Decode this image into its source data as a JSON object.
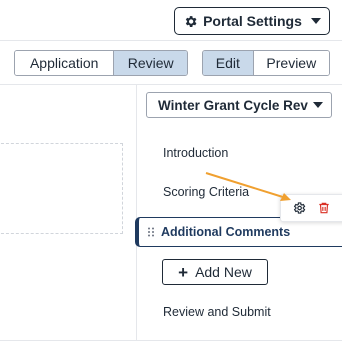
{
  "header": {
    "portal_settings_label": "Portal Settings",
    "portal_settings_icon": "gear-icon",
    "portal_settings_caret": "chevron-down-icon"
  },
  "mode_toggle": {
    "options": [
      {
        "label": "Application",
        "active": false
      },
      {
        "label": "Review",
        "active": true
      }
    ]
  },
  "view_toggle": {
    "options": [
      {
        "label": "Edit",
        "active": true
      },
      {
        "label": "Preview",
        "active": false
      }
    ]
  },
  "cycle_select": {
    "value": "Winter Grant Cycle Rev",
    "caret_icon": "chevron-down-icon"
  },
  "sections": {
    "items": [
      {
        "label": "Introduction"
      },
      {
        "label": "Scoring Criteria"
      },
      {
        "label": "Additional Comments",
        "active": true
      },
      {
        "label": "Review and Submit"
      }
    ],
    "add_new_label": "Add New",
    "item_actions": {
      "settings_icon": "gear-icon",
      "delete_icon": "trash-icon"
    }
  },
  "colors": {
    "active_toggle_bg": "#c9d9ea",
    "active_item_border": "#1f3a5f",
    "delete_red": "#d93025",
    "annotation_arrow": "#f0a030"
  }
}
